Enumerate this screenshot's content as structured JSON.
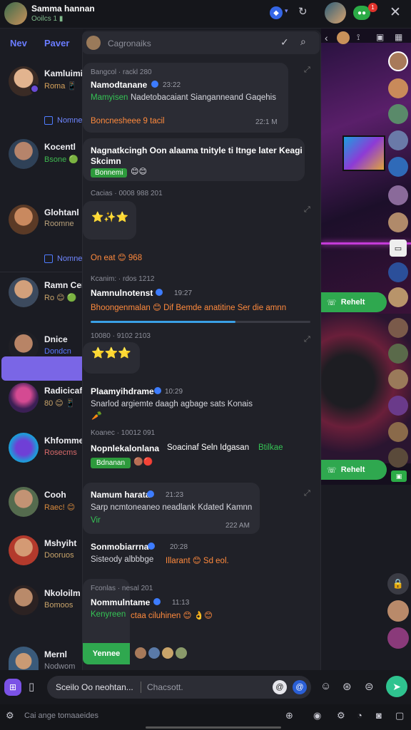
{
  "header": {
    "title": "Samma hannan",
    "subtitle": "Ooilcs 1 ▮",
    "badge_count": "1"
  },
  "tabs": [
    {
      "label": "Nev"
    },
    {
      "label": "Paver"
    }
  ],
  "search": {
    "placeholder": "Cagronaiks"
  },
  "conversations": [
    {
      "name": "Kamluimi",
      "sub": "Roma 📱",
      "sub_color": "#d7a35c",
      "action": "Nomne"
    },
    {
      "name": "Kocentl",
      "sub": "Bsone 🟢",
      "sub_color": "#3fb950"
    },
    {
      "name": "Glohtanl",
      "sub": "Roomne",
      "sub_color": "#b8a07a",
      "action": "Nomne"
    },
    {
      "name": "Ramn Cem",
      "sub": "Ro 😊 🟢",
      "sub_color": "#c9a46a"
    },
    {
      "name": "Dnice",
      "sub": "Dondcn",
      "sub_color": "#5a78ff"
    },
    {
      "name": "Radicicafe",
      "sub": "80 😊 📱",
      "sub_color": "#c9a46a"
    },
    {
      "name": "Khfomme",
      "sub": "Rosecms",
      "sub_color": "#d86a6a"
    },
    {
      "name": "Cooh",
      "sub": "Raec! 😊",
      "sub_color": "#d88a3d"
    },
    {
      "name": "Mshyiht",
      "sub": "Dooruos",
      "sub_color": "#c9a46a"
    },
    {
      "name": "Nkoloilm",
      "sub": "Bomoos",
      "sub_color": "#c9a46a"
    },
    {
      "name": "Mernl",
      "sub": "Nodwom",
      "sub_color": "#8d8f9a"
    }
  ],
  "messages": [
    {
      "meta": "Bangcol · rackl 280",
      "sender": "Namodtanane",
      "time": "23:22",
      "line1": "Mamyisen",
      "line1b": "Nadetobacaiant Sianganneand Gaqehis",
      "line2": "Boncnesheee 9 tacil",
      "stamp": "22:1 M"
    },
    {
      "meta": "",
      "sender": "Nagnatkcingh Oon alaama tnityle ti Itnge later Keagi",
      "sender2": "Skcimn",
      "tag": "Bonnemi"
    },
    {
      "meta": "Cacias · 0008 988 201",
      "emoji": "⭐✨⭐"
    },
    {
      "meta": "",
      "line": "On eat 😊 968"
    },
    {
      "meta": "Kcanim: · rdos 1212",
      "sender": "Namnulnotenst",
      "time": "19:27",
      "line": "Bhoongenmalan 😊 Dif Bemde anatitine Ser die amnn"
    },
    {
      "meta": "10080 · 9102 2103",
      "emoji": "⭐⭐⭐"
    },
    {
      "sender": "Plaamyihdrame",
      "time": "10:29",
      "line": "Snarlod argiemte daagh agbage sats Konais"
    },
    {
      "meta": "Koanec · 10012 091",
      "sender": "Nopnlekalonlana",
      "text": "Soacinaf Seln Idgasan",
      "green": "Btilkae",
      "tag": "Bdnanan"
    },
    {
      "sender": "Namum harata",
      "time": "21:23",
      "line": "Sarp ncmtoneaneo neadlank Kdated Kamnn",
      "line2": "Vir",
      "stamp": "222 AM"
    },
    {
      "sender": "Sonmobiarrna",
      "time": "20:28",
      "line": "Sisteody albbbge",
      "orange": "Illarant 😊 Sd eol."
    },
    {
      "meta": "Fconlas · nesal 201",
      "sender": "Nommulntame",
      "time": "11:13",
      "line": "Kenyreen",
      "line_b": "ctaa ciluhinen 😊 👌😊"
    }
  ],
  "video_call_buttons": [
    {
      "label": "Rehelt"
    },
    {
      "label": "Rehelt"
    }
  ],
  "reply_button": {
    "label": "Yennee"
  },
  "composer": {
    "label": "Sceilo Oo neohtan...",
    "placeholder": "Chacsott."
  },
  "bottombar": {
    "hint": "Cai ange tomaaeides"
  },
  "colors": {
    "accent": "#5b6bff",
    "green": "#2fa84f",
    "orange": "#ff8a3d",
    "bg": "#1a1b22"
  }
}
